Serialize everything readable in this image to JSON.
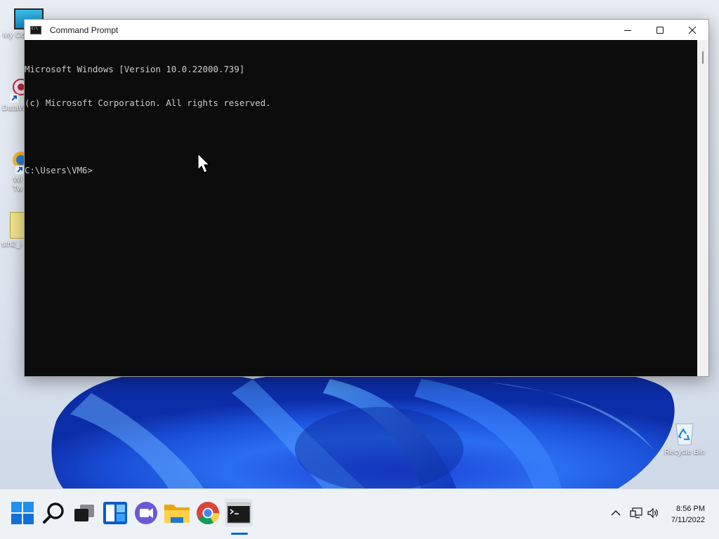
{
  "window": {
    "title": "Command Prompt",
    "minimize_icon": "minimize-icon",
    "maximize_icon": "maximize-icon",
    "close_icon": "close-icon"
  },
  "console": {
    "lines": [
      "Microsoft Windows [Version 10.0.22000.739]",
      "(c) Microsoft Corporation. All rights reserved.",
      "",
      "C:\\Users\\VM6>"
    ]
  },
  "desktop": {
    "icons": [
      {
        "label": "My Co",
        "icon": "computer-icon"
      },
      {
        "label": "DataW",
        "icon": "app-shortcut-icon"
      },
      {
        "label": "Wi\nTw",
        "icon": "app-shortcut-icon"
      },
      {
        "label": "sth2_i",
        "icon": "folder-icon"
      },
      {
        "label": "Recycle Bin",
        "icon": "recycle-bin-icon"
      }
    ]
  },
  "taskbar": {
    "apps": [
      "start-icon",
      "search-icon",
      "task-view-icon",
      "widgets-icon",
      "chat-icon",
      "file-explorer-icon",
      "chrome-icon",
      "command-prompt-icon"
    ],
    "active_app": "command-prompt-icon",
    "tray": [
      "chevron-up-icon",
      "network-icon",
      "volume-icon"
    ],
    "time": "8:56 PM",
    "date": "7/11/2022"
  },
  "colors": {
    "accent": "#0067c0",
    "console_bg": "#0c0c0c",
    "console_text": "#cccccc",
    "taskbar_bg": "#eef1f6"
  }
}
